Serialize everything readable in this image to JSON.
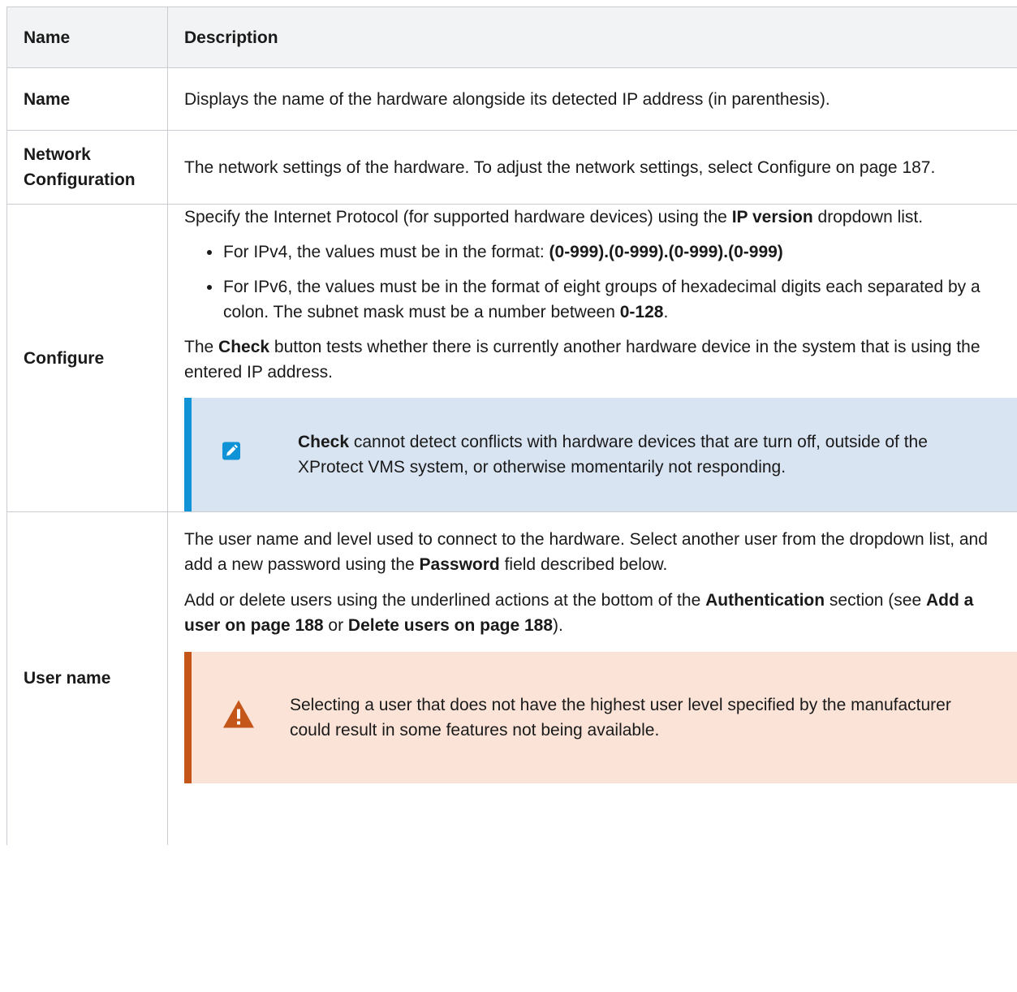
{
  "header": {
    "col_name": "Name",
    "col_description": "Description"
  },
  "rows": {
    "name": {
      "label": "Name",
      "text": "Displays the name of the hardware alongside its detected IP address (in parenthesis)."
    },
    "network": {
      "label_line1": "Network",
      "label_line2": "Configuration",
      "text": "The network settings of the hardware. To adjust the network settings, select Configure on page 187."
    },
    "configure": {
      "label": "Configure",
      "intro_before": "Specify the Internet Protocol (for supported hardware devices) using the ",
      "intro_bold": "IP version",
      "intro_after": " dropdown list.",
      "bullet1_before": "For IPv4, the values must be in the format: ",
      "bullet1_bold": "(0-999).(0-999).(0-999).(0-999)",
      "bullet2_before": "For IPv6, the values must be in the format of eight groups of hexadecimal digits each separated by a colon. The subnet mask must be a number between ",
      "bullet2_bold": "0-128",
      "bullet2_after": ".",
      "check_before": "The ",
      "check_bold": "Check",
      "check_after": " button tests whether there is currently another hardware device in the system that is using the entered IP address.",
      "note_bold": "Check",
      "note_text": " cannot detect conflicts with hardware devices that are turn off, outside of the XProtect VMS system, or otherwise momentarily not responding."
    },
    "username": {
      "label": "User name",
      "p1_before": "The user name and level used to connect to the hardware. Select another user from the dropdown list, and add a new password using the ",
      "p1_bold": "Password",
      "p1_after": " field described below.",
      "p2_before": "Add or delete users using the underlined actions at the bottom of the ",
      "p2_bold1": "Authentication",
      "p2_mid1": " section (see ",
      "p2_bold2": "Add a user on page 188",
      "p2_mid2": " or ",
      "p2_bold3": "Delete users on page 188",
      "p2_after": ").",
      "warning_text": "Selecting a user that does not have the highest user level specified by the manufacturer could result in some features not being available."
    }
  },
  "icons": {
    "note": "pencil-icon",
    "warning": "warning-triangle-icon"
  },
  "colors": {
    "note_bg": "#d9e4f2",
    "note_bar": "#0f92d6",
    "warning_bg": "#fbe3d7",
    "warning_bar": "#c4561a",
    "header_bg": "#f2f3f4"
  }
}
